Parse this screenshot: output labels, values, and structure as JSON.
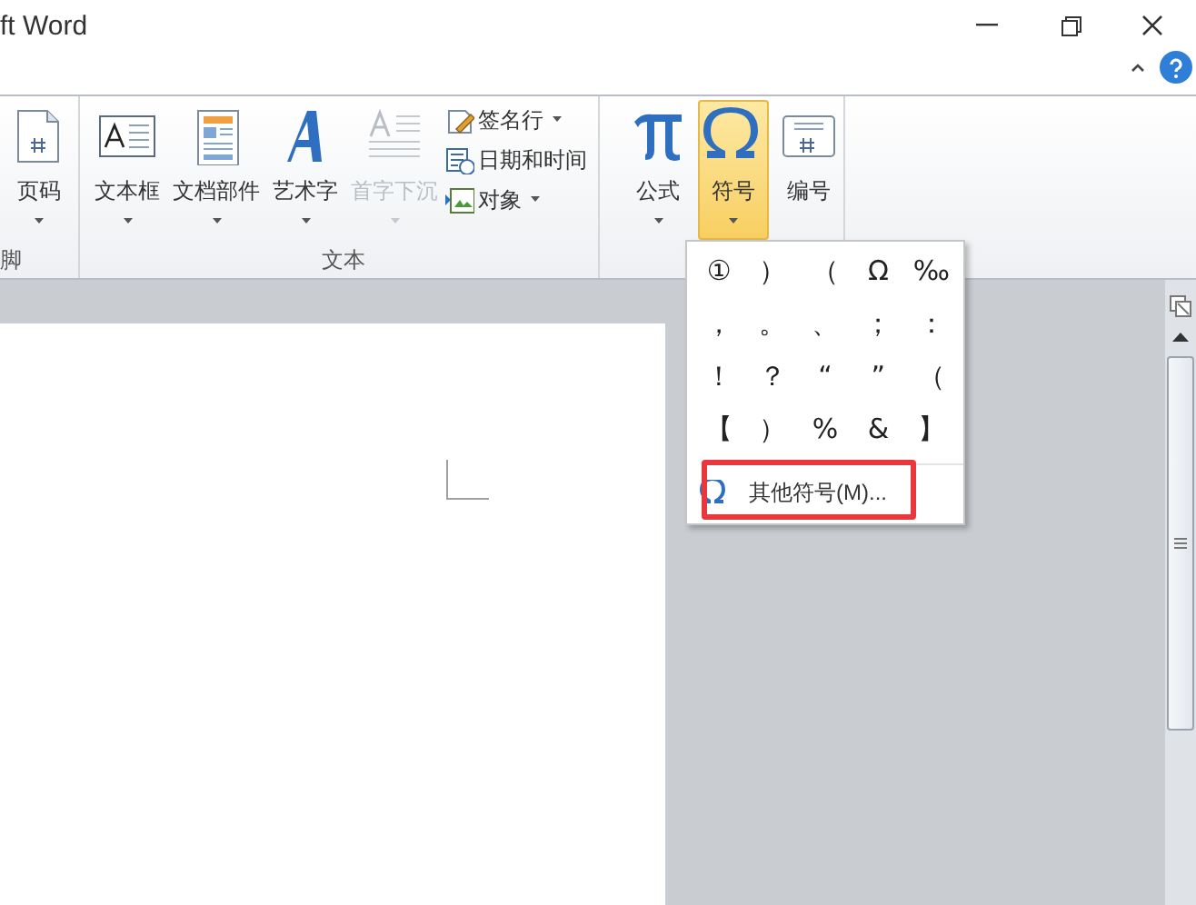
{
  "window": {
    "title": "ft Word"
  },
  "ribbon": {
    "groups": [
      {
        "label": "脚",
        "items": [
          {
            "kind": "large",
            "label": "页码",
            "dropdown": true,
            "disabled": false,
            "selected": false
          }
        ]
      },
      {
        "label": "文本",
        "items": [
          {
            "kind": "large",
            "label": "文本框",
            "dropdown": true,
            "disabled": false,
            "selected": false
          },
          {
            "kind": "large",
            "label": "文档部件",
            "dropdown": true,
            "disabled": false,
            "selected": false
          },
          {
            "kind": "large",
            "label": "艺术字",
            "dropdown": true,
            "disabled": false,
            "selected": false
          },
          {
            "kind": "large",
            "label": "首字下沉",
            "dropdown": true,
            "disabled": true,
            "selected": false
          },
          {
            "kind": "stack",
            "items": [
              {
                "label": "签名行",
                "dropdown": true
              },
              {
                "label": "日期和时间",
                "dropdown": false
              },
              {
                "label": "对象",
                "dropdown": true
              }
            ]
          }
        ]
      },
      {
        "items": [
          {
            "kind": "large",
            "label": "公式",
            "dropdown": true,
            "disabled": false,
            "selected": false
          },
          {
            "kind": "large",
            "label": "符号",
            "dropdown": true,
            "disabled": false,
            "selected": true
          },
          {
            "kind": "large",
            "label": "编号",
            "dropdown": false,
            "disabled": false,
            "selected": false
          }
        ]
      }
    ]
  },
  "symbol_menu": {
    "symbols": [
      [
        "①",
        "）",
        "（",
        "Ω",
        "‰"
      ],
      [
        "，",
        "。",
        "、",
        "；",
        "："
      ],
      [
        "！",
        "？",
        "“",
        "”",
        "（"
      ],
      [
        "【",
        "）",
        "%",
        "&",
        "】"
      ]
    ],
    "more": {
      "label": "其他符号(M)...",
      "highlighted": true
    }
  }
}
